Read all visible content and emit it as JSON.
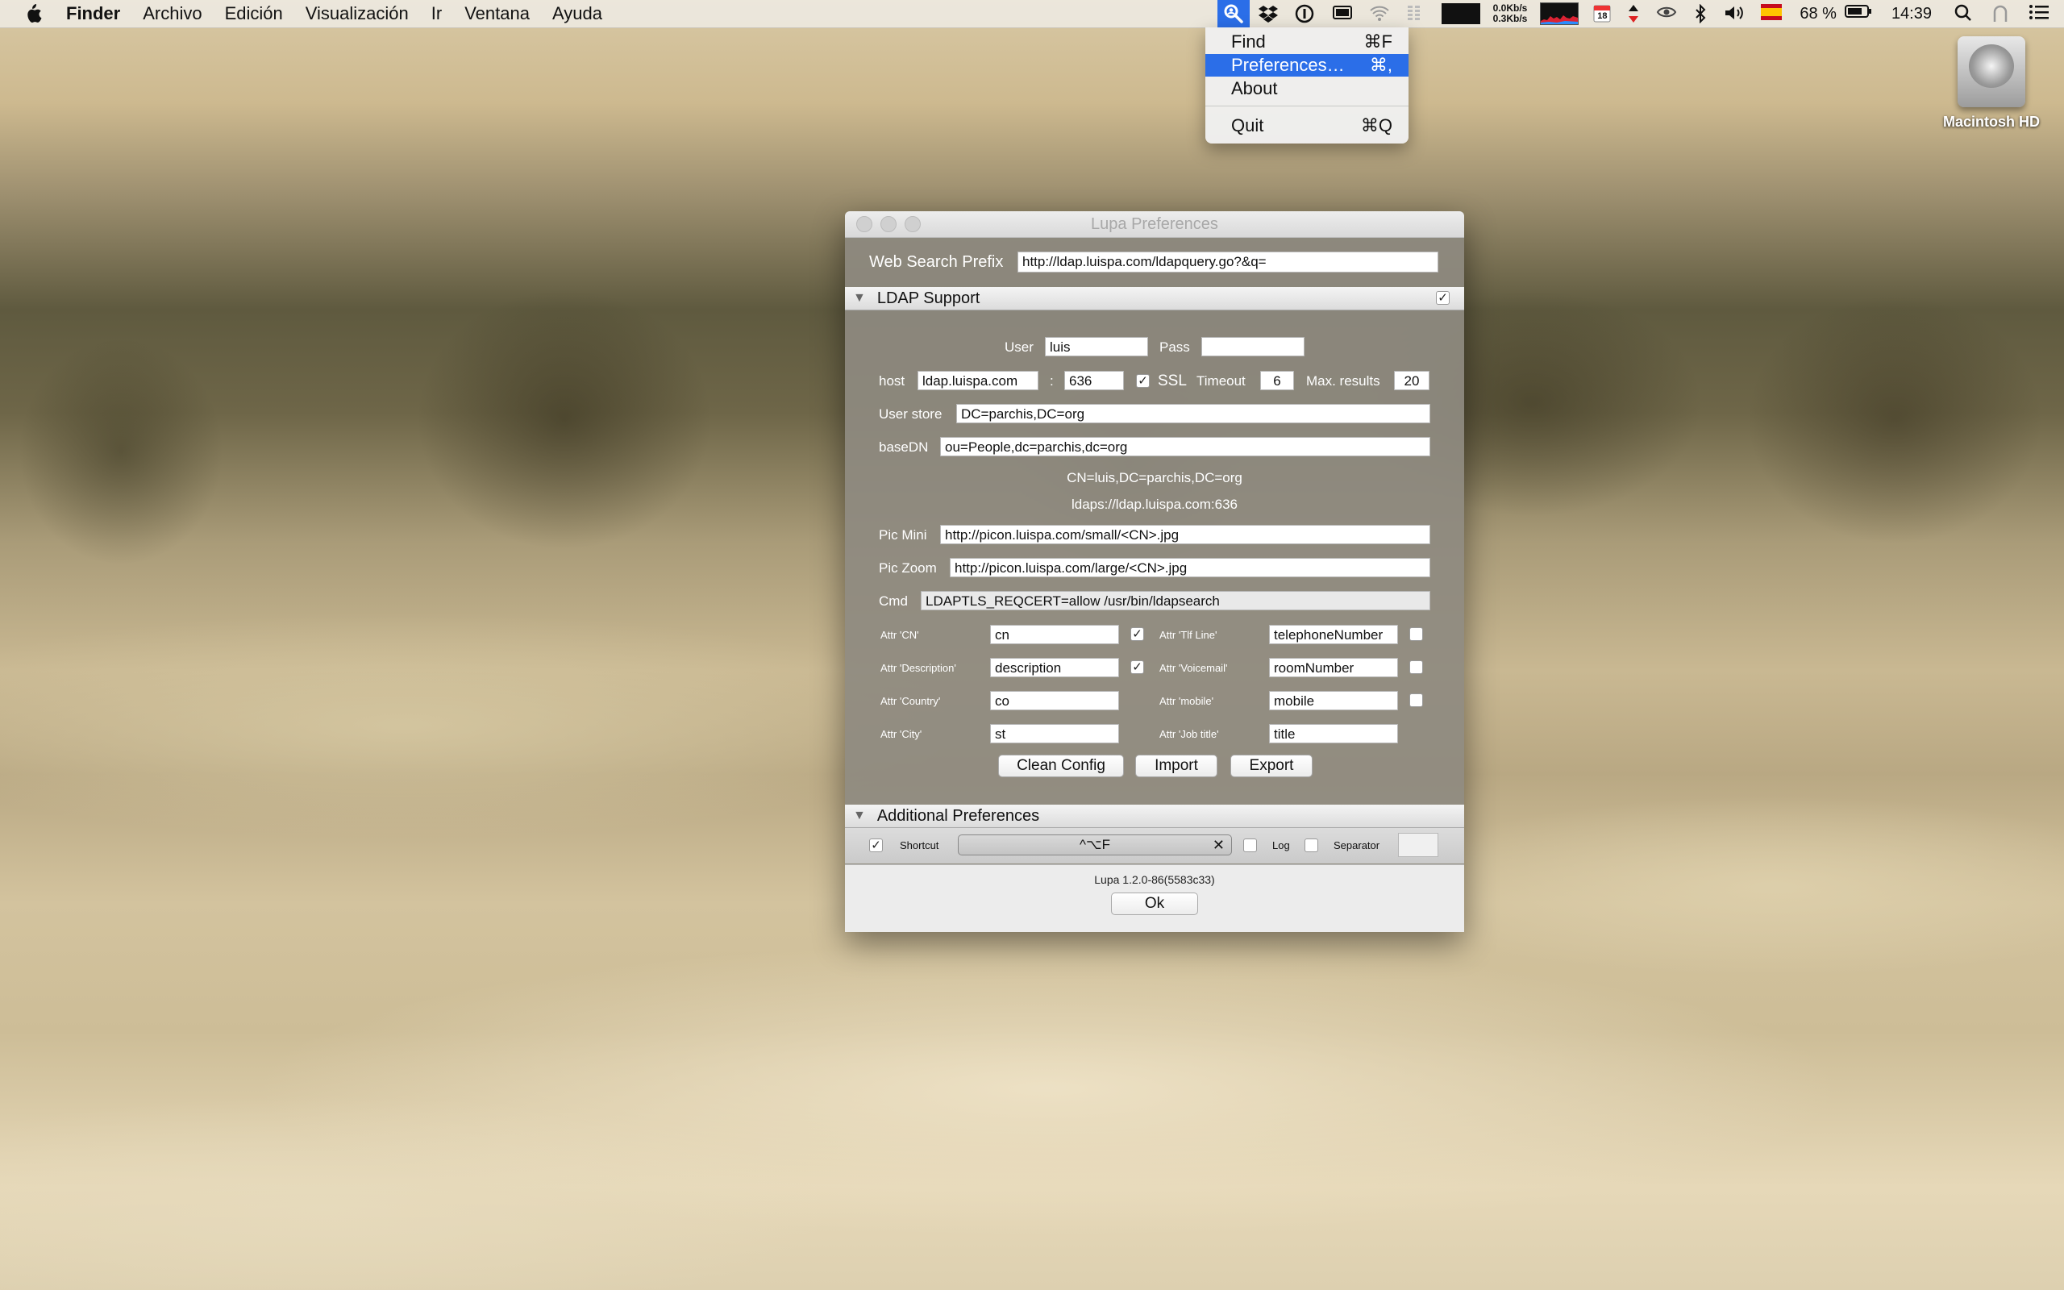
{
  "menubar": {
    "app": "Finder",
    "items": [
      "Archivo",
      "Edición",
      "Visualización",
      "Ir",
      "Ventana",
      "Ayuda"
    ],
    "net_up": "0.0Kb/s",
    "net_down": "0.3Kb/s",
    "calendar_day": "18",
    "battery": "68 %",
    "time": "14:39"
  },
  "dropdown": {
    "items": [
      {
        "label": "Find",
        "shortcut": "⌘F"
      },
      {
        "label": "Preferences…",
        "shortcut": "⌘,"
      },
      {
        "label": "About",
        "shortcut": ""
      },
      {
        "label": "Quit",
        "shortcut": "⌘Q"
      }
    ],
    "selected": "Preferences…"
  },
  "desktop": {
    "hd_label": "Macintosh HD"
  },
  "window": {
    "title": "Lupa Preferences",
    "web_search_prefix_label": "Web Search Prefix",
    "web_search_prefix_value": "http://ldap.luispa.com/ldapquery.go?&q=",
    "ldap": {
      "section_title": "LDAP Support",
      "enabled": true,
      "user_label": "User",
      "user_value": "luis",
      "pass_label": "Pass",
      "pass_value": "",
      "host_label": "host",
      "host_value": "ldap.luispa.com",
      "port_sep": ":",
      "port_value": "636",
      "ssl_label": "SSL",
      "ssl_checked": true,
      "timeout_label": "Timeout",
      "timeout_value": "6",
      "max_results_label": "Max. results",
      "max_results_value": "20",
      "user_store_label": "User store",
      "user_store_value": "DC=parchis,DC=org",
      "basedn_label": "baseDN",
      "basedn_value": "ou=People,dc=parchis,dc=org",
      "info_cn": "CN=luis,DC=parchis,DC=org",
      "info_url": "ldaps://ldap.luispa.com:636",
      "pic_mini_label": "Pic Mini",
      "pic_mini_value": "http://picon.luispa.com/small/<CN>.jpg",
      "pic_zoom_label": "Pic Zoom",
      "pic_zoom_value": "http://picon.luispa.com/large/<CN>.jpg",
      "cmd_label": "Cmd",
      "cmd_value": "LDAPTLS_REQCERT=allow /usr/bin/ldapsearch",
      "attrs_left": [
        {
          "label": "Attr 'CN'",
          "value": "cn",
          "checked": true
        },
        {
          "label": "Attr 'Description'",
          "value": "description",
          "checked": true
        },
        {
          "label": "Attr 'Country'",
          "value": "co",
          "checked": null
        },
        {
          "label": "Attr 'City'",
          "value": "st",
          "checked": null
        }
      ],
      "attrs_right": [
        {
          "label": "Attr 'Tlf Line'",
          "value": "telephoneNumber",
          "checked": false
        },
        {
          "label": "Attr 'Voicemail'",
          "value": "roomNumber",
          "checked": false
        },
        {
          "label": "Attr 'mobile'",
          "value": "mobile",
          "checked": false
        },
        {
          "label": "Attr 'Job title'",
          "value": "title",
          "checked": null
        }
      ],
      "clean_config": "Clean Config",
      "import": "Import",
      "export": "Export"
    },
    "additional": {
      "section_title": "Additional Preferences",
      "shortcut_checked": true,
      "shortcut_label": "Shortcut",
      "shortcut_value": "^⌥F",
      "log_label": "Log",
      "log_checked": false,
      "separator_label": "Separator",
      "separator_checked": false
    },
    "version": "Lupa 1.2.0-86(5583c33)",
    "ok": "Ok"
  }
}
